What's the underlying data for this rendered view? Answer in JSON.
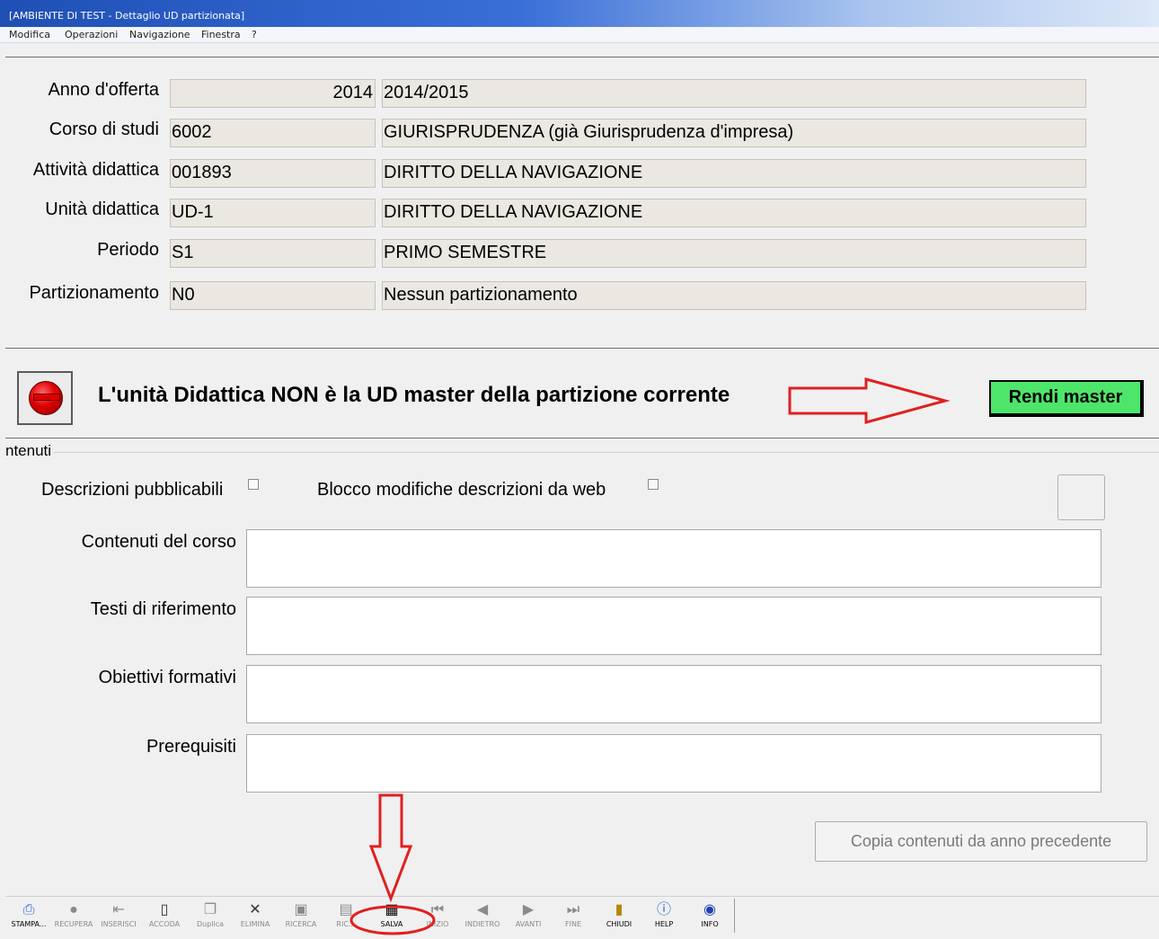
{
  "window": {
    "title": "[AMBIENTE DI TEST - Dettaglio UD partizionata]"
  },
  "menubar": {
    "items": [
      "Modifica",
      "Operazioni",
      "Navigazione",
      "Finestra",
      "?"
    ]
  },
  "fields": [
    {
      "label": "Anno d'offerta",
      "code": "2014",
      "description": "2014/2015"
    },
    {
      "label": "Corso di studi",
      "code": "6002",
      "description": "GIURISPRUDENZA (già Giurisprudenza d'impresa)"
    },
    {
      "label": "Attività didattica",
      "code": "001893",
      "description": "DIRITTO DELLA NAVIGAZIONE"
    },
    {
      "label": "Unità didattica",
      "code": "UD-1",
      "description": "DIRITTO DELLA NAVIGAZIONE"
    },
    {
      "label": "Periodo",
      "code": "S1",
      "description": "PRIMO SEMESTRE"
    },
    {
      "label": "Partizionamento",
      "code": "N0",
      "description": "Nessun partizionamento"
    }
  ],
  "status": {
    "icon": "red-stop-light-icon",
    "message": "L'unità Didattica NON è la UD master della partizione corrente"
  },
  "rendi_master_label": "Rendi master",
  "contenuti": {
    "section_label": "ntenuti",
    "checkbox_publishable": "Descrizioni pubblicabili",
    "checkbox_block_web": "Blocco modifiche descrizioni da web",
    "textareas": [
      {
        "label": "Contenuti del corso",
        "value": ""
      },
      {
        "label": "Testi di riferimento",
        "value": ""
      },
      {
        "label": "Obiettivi formativi",
        "value": ""
      },
      {
        "label": "Prerequisiti",
        "value": ""
      }
    ],
    "copy_button": "Copia contenuti da anno precedente"
  },
  "toolbar": [
    {
      "label": "STAMPA...",
      "icon": "printer-icon",
      "enabled": true
    },
    {
      "label": "RECUPERA",
      "icon": "retrieve-icon",
      "enabled": false
    },
    {
      "label": "INSERISCI",
      "icon": "insert-icon",
      "enabled": false
    },
    {
      "label": "ACCODA",
      "icon": "append-icon",
      "enabled": false
    },
    {
      "label": "Duplica",
      "icon": "duplicate-icon",
      "enabled": false
    },
    {
      "label": "ELIMINA",
      "icon": "delete-icon",
      "enabled": false
    },
    {
      "label": "RICERCA",
      "icon": "search-icon",
      "enabled": false
    },
    {
      "label": "RIC...",
      "icon": "search-next-icon",
      "enabled": false
    },
    {
      "label": "SALVA",
      "icon": "save-icon",
      "enabled": true
    },
    {
      "label": "INIZIO",
      "icon": "first-record-icon",
      "enabled": false
    },
    {
      "label": "INDIETRO",
      "icon": "previous-record-icon",
      "enabled": false
    },
    {
      "label": "AVANTI",
      "icon": "next-record-icon",
      "enabled": false
    },
    {
      "label": "FINE",
      "icon": "last-record-icon",
      "enabled": false
    },
    {
      "label": "CHIUDI",
      "icon": "close-door-icon",
      "enabled": true
    },
    {
      "label": "HELP",
      "icon": "help-icon",
      "enabled": true
    },
    {
      "label": "INFO",
      "icon": "info-icon",
      "enabled": true
    }
  ],
  "colors": {
    "annotation_red": "#e02020",
    "master_button": "#4de66a",
    "field_bg": "#ebe7e1",
    "titlebar": "#1f4fb5"
  }
}
